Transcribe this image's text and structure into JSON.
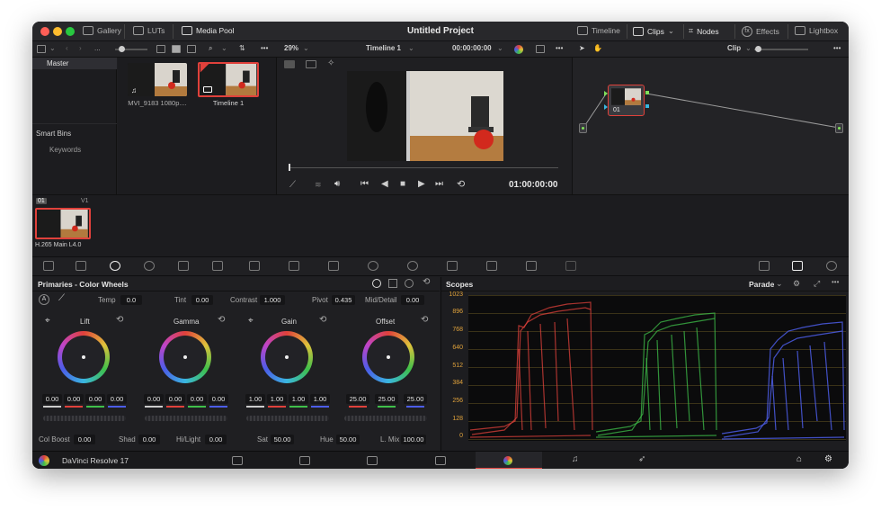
{
  "topbar": {
    "gallery": "Gallery",
    "luts": "LUTs",
    "media_pool": "Media Pool",
    "project_title": "Untitled Project",
    "timeline": "Timeline",
    "clips": "Clips",
    "nodes": "Nodes",
    "effects": "Effects",
    "lightbox": "Lightbox"
  },
  "toolbar": {
    "path_dots": "...",
    "zoom": "29%",
    "timeline_name": "Timeline 1",
    "timecode": "00:00:00:00",
    "clip_mode": "Clip"
  },
  "bins": {
    "master": "Master",
    "smart_bins": "Smart Bins",
    "keywords": "Keywords"
  },
  "media": [
    {
      "name": "MVI_9183 1080p...."
    },
    {
      "name": "Timeline 1"
    }
  ],
  "viewer": {
    "timecode": "01:00:00:00"
  },
  "node": {
    "label": "01"
  },
  "timeline_strip": {
    "clip_num": "01",
    "track": "V1",
    "codec": "H.265 Main L4.0"
  },
  "primaries": {
    "title": "Primaries - Color Wheels",
    "a_label": "A",
    "temp_label": "Temp",
    "temp": "0.0",
    "tint_label": "Tint",
    "tint": "0.00",
    "contrast_label": "Contrast",
    "contrast": "1.000",
    "pivot_label": "Pivot",
    "pivot": "0.435",
    "middetail_label": "Mid/Detail",
    "middetail": "0.00",
    "wheels": [
      {
        "name": "Lift",
        "values": [
          "0.00",
          "0.00",
          "0.00",
          "0.00"
        ]
      },
      {
        "name": "Gamma",
        "values": [
          "0.00",
          "0.00",
          "0.00",
          "0.00"
        ]
      },
      {
        "name": "Gain",
        "values": [
          "1.00",
          "1.00",
          "1.00",
          "1.00"
        ]
      },
      {
        "name": "Offset",
        "values": [
          "25.00",
          "25.00",
          "25.00"
        ]
      }
    ],
    "colboost_label": "Col Boost",
    "colboost": "0.00",
    "shad_label": "Shad",
    "shad": "0.00",
    "hilight_label": "Hi/Light",
    "hilight": "0.00",
    "sat_label": "Sat",
    "sat": "50.00",
    "hue_label": "Hue",
    "hue": "50.00",
    "lmix_label": "L. Mix",
    "lmix": "100.00"
  },
  "scopes": {
    "title": "Scopes",
    "mode": "Parade",
    "ticks": [
      "1023",
      "896",
      "768",
      "640",
      "512",
      "384",
      "256",
      "128",
      "0"
    ]
  },
  "bottombar": {
    "app_name": "DaVinci Resolve 17"
  },
  "colors": {
    "red": "#e0413b",
    "green": "#3fc04a",
    "blue": "#4c5de8",
    "accent": "#e0413b"
  }
}
